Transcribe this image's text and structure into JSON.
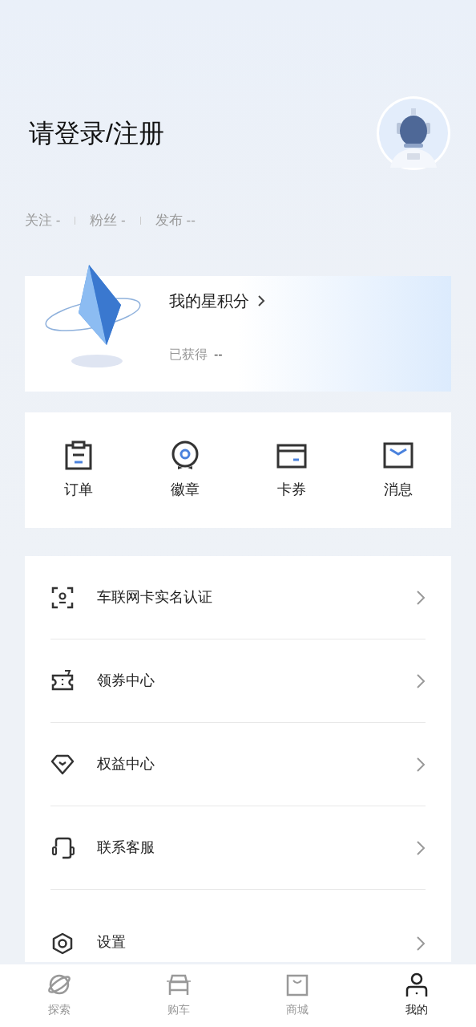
{
  "header": {
    "title": "请登录/注册"
  },
  "stats": [
    {
      "label": "关注",
      "value": "-"
    },
    {
      "label": "粉丝",
      "value": "-"
    },
    {
      "label": "发布",
      "value": "--"
    }
  ],
  "points_card": {
    "title": "我的星积分",
    "earned_label": "已获得",
    "earned_value": "--"
  },
  "shortcuts": [
    {
      "label": "订单"
    },
    {
      "label": "徽章"
    },
    {
      "label": "卡券"
    },
    {
      "label": "消息"
    }
  ],
  "menu": [
    {
      "label": "车联网卡实名认证"
    },
    {
      "label": "领券中心"
    },
    {
      "label": "权益中心"
    },
    {
      "label": "联系客服"
    },
    {
      "label": "设置"
    }
  ],
  "tab_bar": [
    {
      "label": "探索",
      "selected": false
    },
    {
      "label": "购车",
      "selected": false
    },
    {
      "label": "商城",
      "selected": false
    },
    {
      "label": "我的",
      "selected": true
    }
  ]
}
